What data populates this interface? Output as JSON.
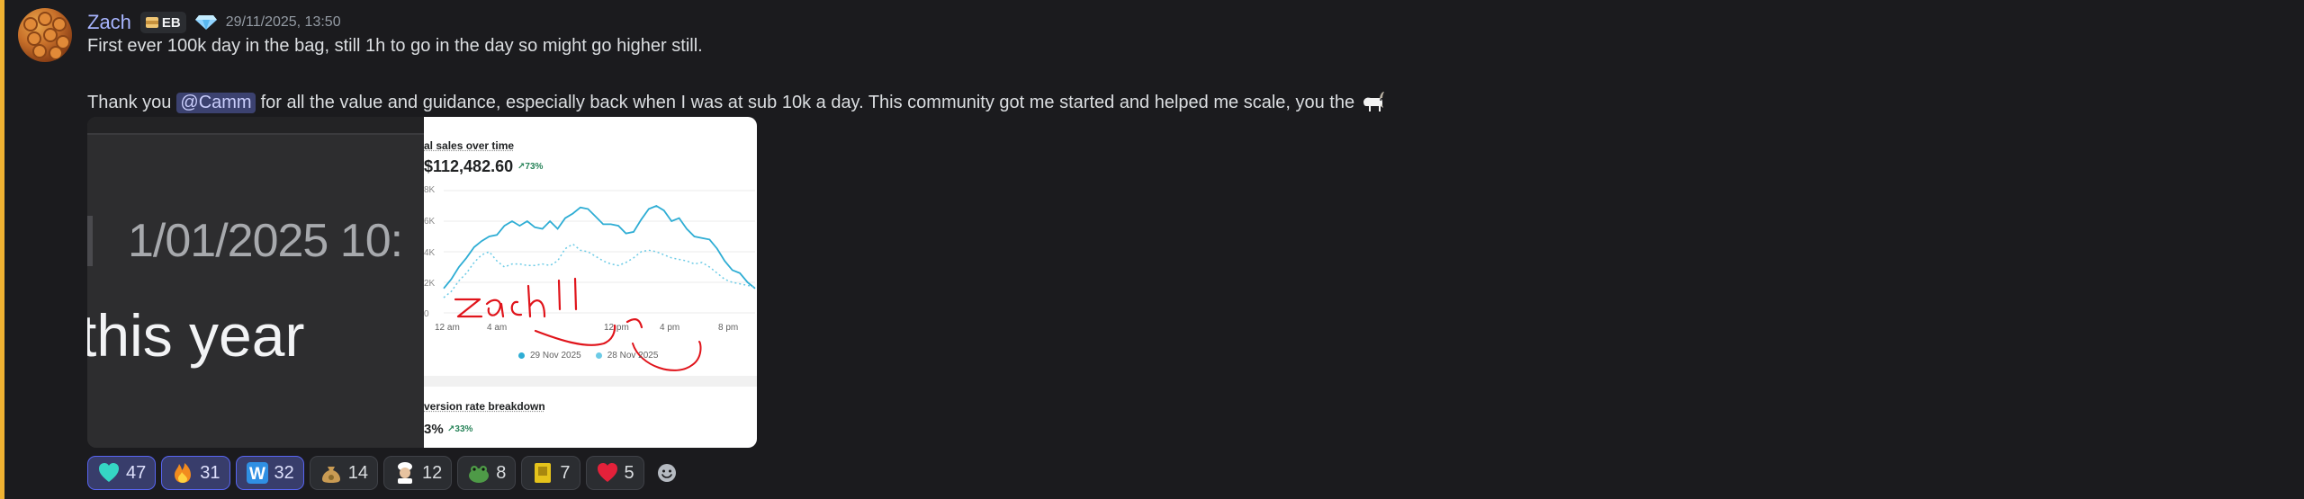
{
  "message": {
    "author": "Zach",
    "badge": "EB",
    "timestamp": "29/11/2025, 13:50",
    "line1": "First ever 100k day in the bag, still 1h to go in the day so might go higher still.",
    "line2_before": "Thank you",
    "mention": "@Camm",
    "line2_after": "for all the value and guidance, especially back when I was at sub 10k a day. This community got me started and helped me scale, you the",
    "emoji": "goat-icon"
  },
  "attachment": {
    "left_image": {
      "date_text": "1/01/2025 10:",
      "caption_text": "this year"
    },
    "right_image": {
      "sales_title": "al sales over time",
      "sales_value": "$112,482.60",
      "sales_change": "↗73%",
      "y_ticks": [
        "8K",
        "6K",
        "4K",
        "2K",
        "0"
      ],
      "x_ticks": [
        "12 am",
        "4 am",
        "12 pm",
        "4 pm",
        "8 pm"
      ],
      "legend": [
        "29 Nov 2025",
        "28 Nov 2025"
      ],
      "scribble": "zach",
      "conversion_title": "version rate breakdown",
      "conversion_value": "3%",
      "conversion_change": "↗33%"
    }
  },
  "chart_data": {
    "type": "line",
    "title": "al sales over time",
    "x": [
      0,
      1,
      2,
      3,
      4,
      5,
      6,
      7,
      8,
      9,
      10,
      11,
      12,
      13,
      14,
      15,
      16,
      17,
      18,
      19,
      20,
      21,
      22,
      23,
      24,
      25,
      26,
      27,
      28,
      29,
      30,
      31,
      32,
      33,
      34,
      35,
      36,
      37,
      38,
      39,
      40,
      41
    ],
    "series": [
      {
        "name": "29 Nov 2025",
        "values": [
          1.6,
          2.2,
          3.0,
          3.6,
          4.3,
          4.7,
          5.0,
          5.1,
          5.7,
          6.0,
          5.7,
          6.0,
          5.6,
          5.5,
          6.0,
          5.5,
          6.2,
          6.5,
          6.9,
          6.8,
          6.3,
          5.8,
          5.8,
          5.7,
          5.2,
          5.3,
          6.1,
          6.8,
          7.0,
          6.7,
          6.0,
          6.2,
          5.5,
          5.0,
          4.9,
          4.8,
          4.2,
          3.4,
          2.8,
          2.6,
          2.0,
          1.6
        ]
      },
      {
        "name": "28 Nov 2025",
        "values": [
          1.0,
          1.4,
          2.1,
          2.6,
          3.3,
          3.8,
          4.0,
          3.4,
          3.0,
          3.2,
          3.2,
          3.1,
          3.1,
          3.2,
          3.1,
          3.4,
          4.2,
          4.5,
          4.1,
          4.0,
          3.7,
          3.4,
          3.2,
          3.1,
          3.3,
          3.6,
          4.0,
          4.1,
          4.0,
          3.8,
          3.6,
          3.5,
          3.4,
          3.2,
          3.3,
          3.0,
          2.6,
          2.2,
          2.0,
          1.9,
          1.8,
          1.7
        ]
      }
    ],
    "x_tick_labels": [
      "12 am",
      "4 am",
      "12 pm",
      "4 pm",
      "8 pm"
    ],
    "y_tick_labels": [
      "8K",
      "6K",
      "4K",
      "2K",
      "0"
    ],
    "ylim": [
      0,
      8
    ],
    "colors": [
      "#2eadd4",
      "#6ccbe6"
    ],
    "grid": true
  },
  "reactions": [
    {
      "icon": "teal-heart-icon",
      "count": "47",
      "me": true,
      "color": "#35d6c4"
    },
    {
      "icon": "fire-icon",
      "count": "31",
      "me": true,
      "color": "#f28b1e"
    },
    {
      "icon": "letter-w-icon",
      "count": "32",
      "me": true,
      "color": "#2f8fe3",
      "glyph": "W"
    },
    {
      "icon": "money-bag-icon",
      "count": "14",
      "me": false,
      "color": "#c99b53"
    },
    {
      "icon": "chef-icon",
      "count": "12",
      "me": false,
      "color": "#e7c3a0"
    },
    {
      "icon": "frog-icon",
      "count": "8",
      "me": false,
      "color": "#4e9a47"
    },
    {
      "icon": "gold-card-icon",
      "count": "7",
      "me": false,
      "color": "#e5c31b"
    },
    {
      "icon": "red-heart-icon",
      "count": "5",
      "me": false,
      "color": "#e4213a"
    }
  ],
  "colors": {
    "highlight": "#f0b232",
    "username": "#a8b5ff",
    "mention_bg": "#3c4270",
    "positive": "#29845a",
    "scribble": "#e0141b"
  }
}
